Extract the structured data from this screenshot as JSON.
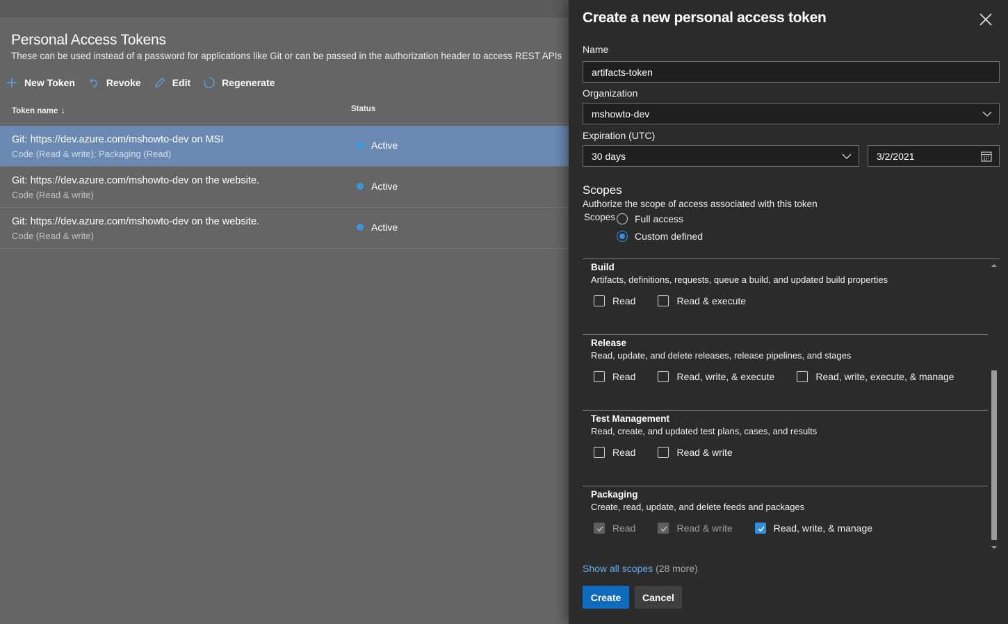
{
  "page": {
    "title": "Personal Access Tokens",
    "description": "These can be used instead of a password for applications like Git or can be passed in the authorization header to access REST APIs"
  },
  "toolbar": {
    "new_token": "New Token",
    "revoke": "Revoke",
    "edit": "Edit",
    "regenerate": "Regenerate"
  },
  "table": {
    "col_name": "Token name",
    "col_status": "Status",
    "rows": [
      {
        "name": "Git: https://dev.azure.com/mshowto-dev on MSI",
        "scopes": "Code (Read & write); Packaging (Read)",
        "status": "Active",
        "selected": true
      },
      {
        "name": "Git: https://dev.azure.com/mshowto-dev on the website.",
        "scopes": "Code (Read & write)",
        "status": "Active",
        "selected": false
      },
      {
        "name": "Git: https://dev.azure.com/mshowto-dev on the website.",
        "scopes": "Code (Read & write)",
        "status": "Active",
        "selected": false
      }
    ]
  },
  "panel": {
    "title": "Create a new personal access token",
    "name_label": "Name",
    "name_value": "artifacts-token",
    "org_label": "Organization",
    "org_value": "mshowto-dev",
    "expiration_label": "Expiration (UTC)",
    "expiration_value": "30 days",
    "expiration_date": "3/2/2021",
    "scopes_heading": "Scopes",
    "scopes_sub": "Authorize the scope of access associated with this token",
    "scopes_label": "Scopes",
    "radio_full": "Full access",
    "radio_custom": "Custom defined",
    "selected_radio": "Custom defined",
    "sections": [
      {
        "name": "Build",
        "desc": "Artifacts, definitions, requests, queue a build, and updated build properties",
        "options": [
          {
            "label": "Read",
            "state": "unchecked"
          },
          {
            "label": "Read & execute",
            "state": "unchecked"
          }
        ]
      },
      {
        "name": "Release",
        "desc": "Read, update, and delete releases, release pipelines, and stages",
        "options": [
          {
            "label": "Read",
            "state": "unchecked"
          },
          {
            "label": "Read, write, & execute",
            "state": "unchecked"
          },
          {
            "label": "Read, write, execute, & manage",
            "state": "unchecked"
          }
        ]
      },
      {
        "name": "Test Management",
        "desc": "Read, create, and updated test plans, cases, and results",
        "options": [
          {
            "label": "Read",
            "state": "unchecked"
          },
          {
            "label": "Read & write",
            "state": "unchecked"
          }
        ]
      },
      {
        "name": "Packaging",
        "desc": "Create, read, update, and delete feeds and packages",
        "options": [
          {
            "label": "Read",
            "state": "implied"
          },
          {
            "label": "Read & write",
            "state": "implied"
          },
          {
            "label": "Read, write, & manage",
            "state": "checked"
          }
        ]
      }
    ],
    "show_all": "Show all scopes",
    "show_all_more": "(28 more)",
    "create": "Create",
    "cancel": "Cancel"
  },
  "colors": {
    "accent": "#0f6cbd",
    "status_dot": "#3a96dd",
    "selected_row": "#6a8ab3",
    "link": "#62aef0"
  }
}
